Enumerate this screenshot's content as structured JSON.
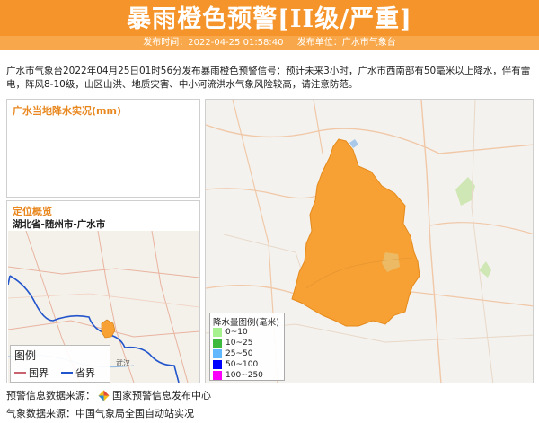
{
  "header": {
    "title": "暴雨橙色预警[II级/严重]",
    "publish_time": "发布时间：2022-04-25 01:58:40",
    "publisher": "发布单位：广水市气象台"
  },
  "description": "广水市气象台2022年04月25日01时56分发布暴雨橙色预警信号：预计未来3小时，广水市西南部有50毫米以上降水，伴有雷电，阵风8-10级，山区山洪、地质灾害、中小河流洪水气象风险较高，请注意防范。",
  "rain_panel": {
    "title": "广水当地降水实况(mm)"
  },
  "location_panel": {
    "title": "定位概览",
    "path": "湖北省-随州市-广水市",
    "legend_title": "图例",
    "legend_items": [
      {
        "label": "国界",
        "color": "#c86470"
      },
      {
        "label": "省界",
        "color": "#2255cc"
      }
    ]
  },
  "rain_legend": {
    "title": "降水量图例(毫米)",
    "items": [
      {
        "label": "0~10",
        "color": "#a6f28f"
      },
      {
        "label": "10~25",
        "color": "#3dba3d"
      },
      {
        "label": "25~50",
        "color": "#61b8ff"
      },
      {
        "label": "50~100",
        "color": "#0000ff"
      },
      {
        "label": "100~250",
        "color": "#fa00fa"
      }
    ]
  },
  "footer": {
    "warning_source_label": "预警信息数据来源：",
    "warning_source": "国家预警信息发布中心",
    "weather_source": "气象数据来源：中国气象局全国自动站实况"
  },
  "colors": {
    "header_bg": "#f5942a",
    "accent": "#e8871e",
    "warning_area": "#f7a034"
  }
}
